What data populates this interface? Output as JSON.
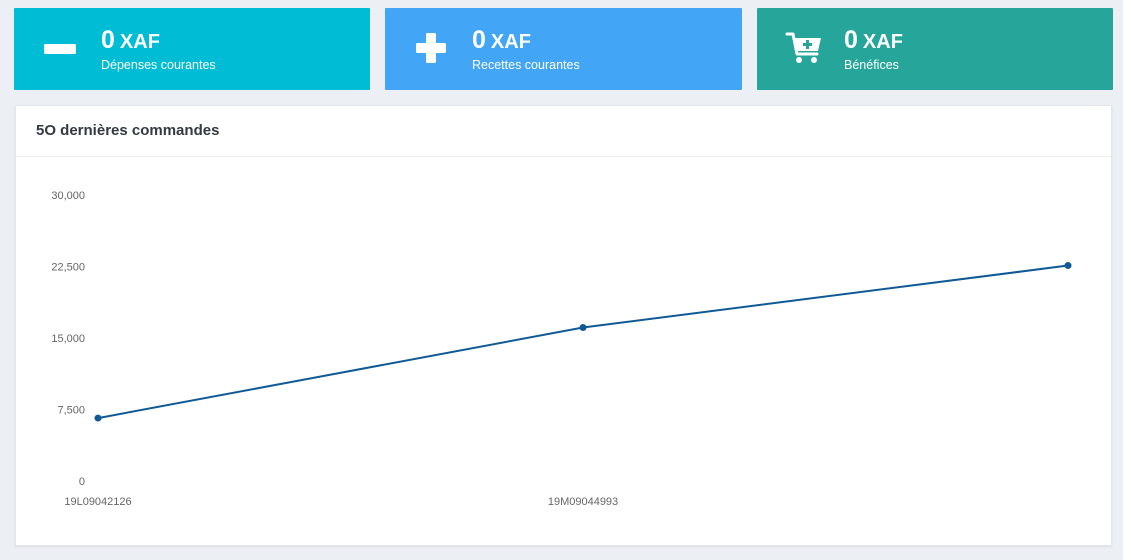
{
  "cards": [
    {
      "amount": "0",
      "currency": "XAF",
      "label": "Dépenses courantes",
      "icon": "minus-icon",
      "color": "#00bcd4"
    },
    {
      "amount": "0",
      "currency": "XAF",
      "label": "Recettes courantes",
      "icon": "plus-icon",
      "color": "#42a5f5"
    },
    {
      "amount": "0",
      "currency": "XAF",
      "label": "Bénéfices",
      "icon": "cart-plus-icon",
      "color": "#26a69a"
    }
  ],
  "panel": {
    "title": "5O dernières commandes"
  },
  "chart_data": {
    "type": "line",
    "title": "",
    "xlabel": "",
    "ylabel": "",
    "x": [
      "19L09042126",
      "19M09044993",
      ""
    ],
    "x_tick_labels": [
      "19L09042126",
      "19M09044993"
    ],
    "series": [
      {
        "values": [
          6600,
          16100,
          22600
        ],
        "color": "#0f5a96"
      }
    ],
    "ylim": [
      0,
      30000
    ],
    "y_ticks": [
      0,
      7500,
      15000,
      22500,
      30000
    ],
    "y_tick_labels": [
      "0",
      "7,500",
      "15,000",
      "22,500",
      "30,000"
    ],
    "grid": false,
    "legend": "none"
  }
}
